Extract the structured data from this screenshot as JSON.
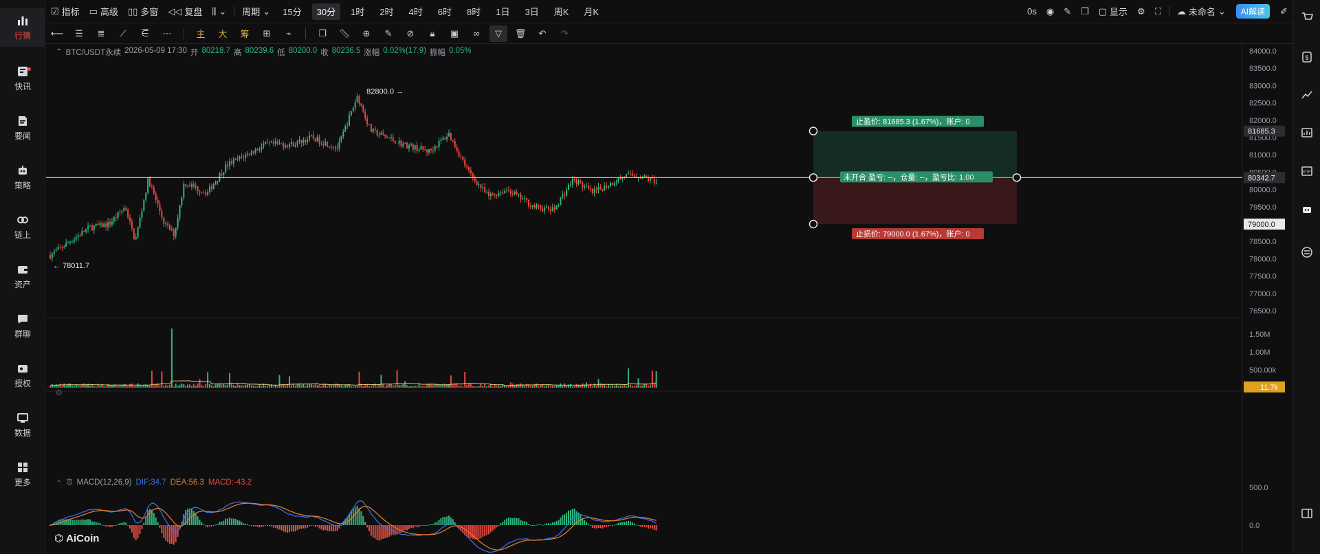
{
  "nav": {
    "items": [
      {
        "label": "行情",
        "icon": "bar-chart-icon",
        "active": true
      },
      {
        "label": "快讯",
        "icon": "newsflash-icon"
      },
      {
        "label": "要闻",
        "icon": "news-icon"
      },
      {
        "label": "策略",
        "icon": "robot-icon"
      },
      {
        "label": "链上",
        "icon": "onchain-icon"
      },
      {
        "label": "资产",
        "icon": "wallet-icon"
      },
      {
        "label": "群聊",
        "icon": "chat-icon"
      },
      {
        "label": "授权",
        "icon": "key-icon"
      },
      {
        "label": "数据",
        "icon": "monitor-icon"
      },
      {
        "label": "更多",
        "icon": "grid-icon"
      }
    ]
  },
  "toolbar": {
    "indicators": "指标",
    "advanced": "高级",
    "multi_window": "多窗",
    "replay": "复盘",
    "period": "周期",
    "timeframes": [
      "15分",
      "30分",
      "1时",
      "2时",
      "4时",
      "6时",
      "8时",
      "1日",
      "3日",
      "周K",
      "月K"
    ],
    "active_timeframe": "30分",
    "countdown": "0s",
    "display": "显示",
    "layout_name": "未命名",
    "ai_button": "AI解读"
  },
  "drawing_tools": {
    "main": "主",
    "big": "大",
    "chip": "筹"
  },
  "chart": {
    "symbol": "BTC/USDT永续",
    "datetime": "2026-05-09 17:30",
    "open_label": "开",
    "open": "80218.7",
    "high_label": "高",
    "high": "80239.6",
    "low_label": "低",
    "low": "80200.0",
    "close_label": "收",
    "close": "80236.5",
    "change_label": "涨幅",
    "change": "0.02%(17.9)",
    "amplitude_label": "振幅",
    "amplitude": "0.05%",
    "price_axis": [
      "84000.0",
      "83500.0",
      "83000.0",
      "82500.0",
      "82000.0",
      "81500.0",
      "81000.0",
      "80500.0",
      "80000.0",
      "79500.0",
      "79000.0",
      "78500.0",
      "78000.0",
      "77500.0",
      "77000.0",
      "76500.0"
    ],
    "current_price": "80342.7",
    "take_profit_price": "81685.3",
    "stop_loss_price": "79000.0",
    "max_label": "82800.0",
    "min_label": "78011.7",
    "tp_text": "止盈价: 81685.3 (1.67%)，账户: 0",
    "sl_text": "止损价: 79000.0 (1.67%)，账户: 0",
    "position_text": "未开合 盈亏: --，仓量: --，盈亏比: 1.00",
    "volume_axis": [
      "1.50M",
      "1.00M",
      "500.00k"
    ],
    "current_volume": "11.7k",
    "macd_title": "MACD(12,26,9)",
    "macd_dif": "DIF:34.7",
    "macd_dea": "DEA:56.3",
    "macd_val": "MACD:-43.2",
    "macd_axis": [
      "500.0",
      "0.0"
    ],
    "logo_text": "AiCoin"
  },
  "colors": {
    "up": "#2fb57e",
    "down": "#e8493f",
    "bg": "#0f0f10",
    "dif": "#3b6fe0",
    "dea": "#e07a2f"
  }
}
